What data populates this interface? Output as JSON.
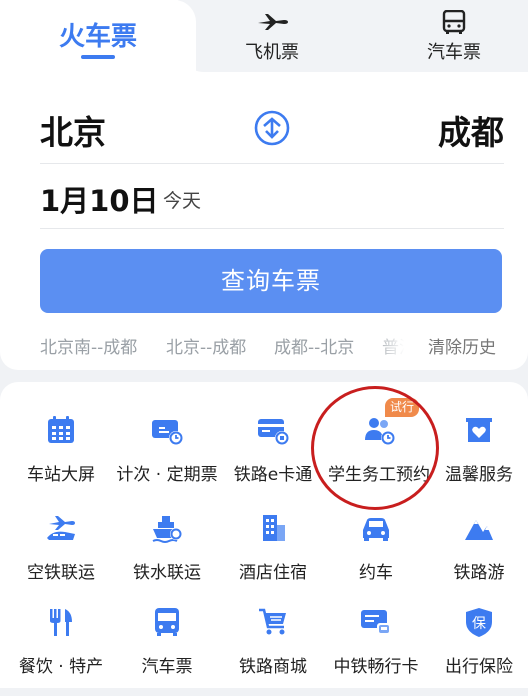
{
  "tabs": [
    {
      "label": "火车票",
      "icon": "train",
      "active": true
    },
    {
      "label": "飞机票",
      "icon": "airplane-icon"
    },
    {
      "label": "汽车票",
      "icon": "bus-icon"
    }
  ],
  "route": {
    "from": "北京",
    "to": "成都"
  },
  "date": {
    "value": "1月10日",
    "sub": "今天"
  },
  "query_button": "查询车票",
  "history": [
    "北京南--成都",
    "北京--成都",
    "成都--北京",
    "普洱"
  ],
  "clear_history": "清除历史",
  "colors": {
    "accent": "#3d7bf0",
    "button": "#5b8ff2",
    "badge": "#f08a4b",
    "ring": "#c81e1e"
  },
  "services": [
    {
      "label": "车站大屏",
      "icon": "calendar-grid-icon"
    },
    {
      "label": "计次 · 定期票",
      "icon": "ticket-clock-icon"
    },
    {
      "label": "铁路e卡通",
      "icon": "card-train-icon"
    },
    {
      "label": "学生务工预约",
      "icon": "people-clock-icon",
      "badge": "试行"
    },
    {
      "label": "温馨服务",
      "icon": "heart-box-icon"
    },
    {
      "label": "空铁联运",
      "icon": "plane-train-icon"
    },
    {
      "label": "铁水联运",
      "icon": "ship-icon"
    },
    {
      "label": "酒店住宿",
      "icon": "hotel-icon"
    },
    {
      "label": "约车",
      "icon": "car-icon"
    },
    {
      "label": "铁路游",
      "icon": "mountain-icon"
    },
    {
      "label": "餐饮 · 特产",
      "icon": "fork-knife-icon"
    },
    {
      "label": "汽车票",
      "icon": "bus-icon"
    },
    {
      "label": "铁路商城",
      "icon": "cart-icon"
    },
    {
      "label": "中铁畅行卡",
      "icon": "train-card-icon"
    },
    {
      "label": "出行保险",
      "icon": "shield-icon",
      "icon_text": "保"
    }
  ]
}
